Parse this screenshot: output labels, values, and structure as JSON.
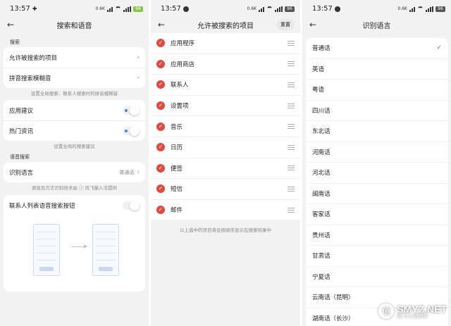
{
  "colors": {
    "accent_red": "#e04a40",
    "accent_blue": "#3b6fe0",
    "background": "#f2f2f2",
    "battery_green": "#8bc34a"
  },
  "status": {
    "time": "13:57",
    "p1": {
      "net": "0.6K",
      "battery": "96"
    },
    "p2": {
      "net": "0.6K",
      "battery": "96"
    },
    "p3": {
      "net": "0.6K",
      "battery": "96"
    }
  },
  "panel1": {
    "title": "搜索和语音",
    "section_search": "搜索",
    "items": [
      {
        "label": "允许被搜索的项目"
      },
      {
        "label": "拼音搜索模糊音"
      }
    ],
    "note_search": "设置全局搜索、联系人搜索时的拼音模糊音",
    "suggest_label": "应用建议",
    "hot_label": "热门资讯",
    "note_suggest": "设置全局的搜索建议",
    "section_voice": "语音搜索",
    "lang_label": "识别语言",
    "lang_value": "普通话",
    "note_voice": "语音及方言识别技术由 ⓘ 讯飞输入法提供",
    "contacts_voice_label": "联系人列表语音搜索按钮"
  },
  "panel2": {
    "title": "允许被搜索的项目",
    "reset_label": "重置",
    "items": [
      "应用程序",
      "应用商店",
      "联系人",
      "设置项",
      "音乐",
      "日历",
      "便签",
      "短信",
      "邮件"
    ],
    "note": "以上选中的项目将会按顺序显示在搜索结果中"
  },
  "panel3": {
    "title": "识别语言",
    "languages": [
      "普通话",
      "英语",
      "粤语",
      "四川话",
      "东北话",
      "河南话",
      "河北话",
      "闽南话",
      "客家话",
      "贵州话",
      "甘肃话",
      "宁夏话",
      "云南话（昆明）",
      "湖南话（长沙）"
    ],
    "selected": "普通话"
  },
  "watermark": {
    "big": "SMYZ.NET",
    "small": "值 什么值得买"
  },
  "icons": [
    "back-icon",
    "check-icon",
    "drag-handle-icon",
    "chevron-right-icon",
    "tick-icon",
    "wifi-icon",
    "signal-icon",
    "battery-icon"
  ]
}
